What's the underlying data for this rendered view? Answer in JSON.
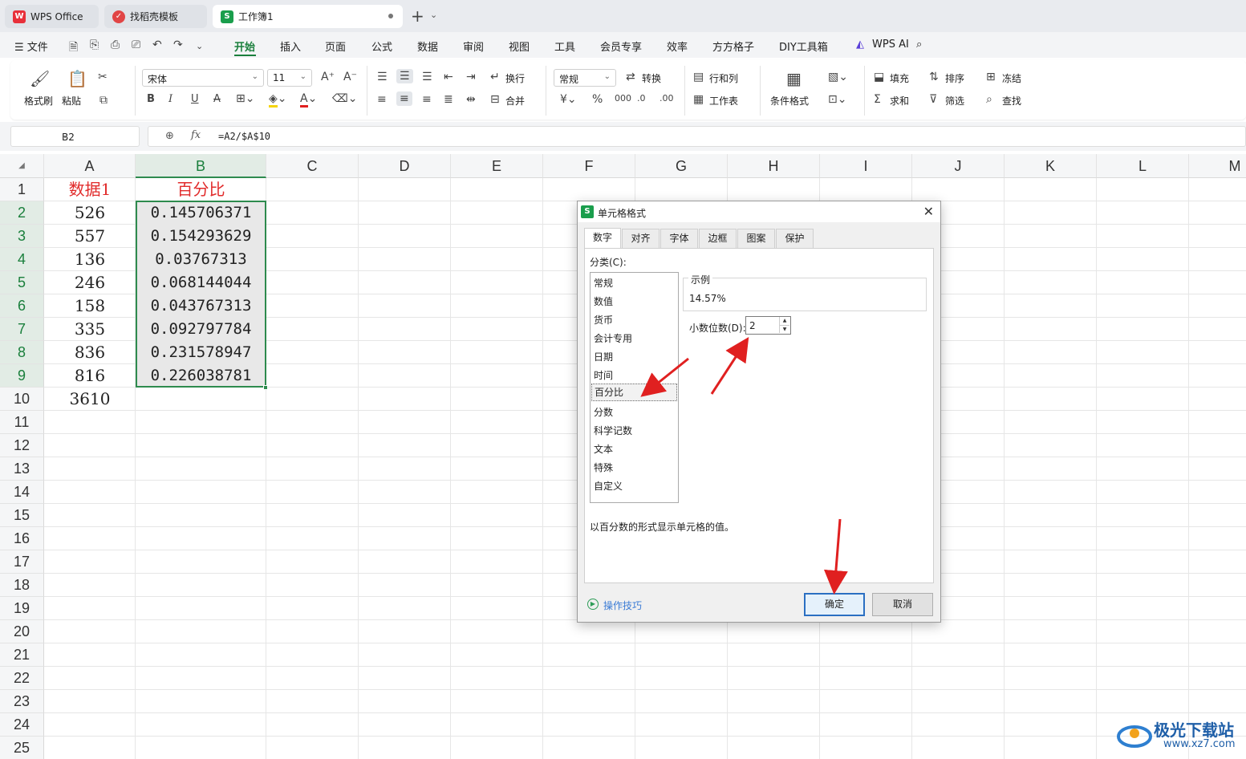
{
  "tabs": [
    {
      "label": "WPS Office",
      "icon": "wps-logo-icon"
    },
    {
      "label": "找稻壳模板",
      "icon": "docer-icon"
    },
    {
      "label": "工作簿1",
      "icon": "sheet-s-icon"
    }
  ],
  "menu": {
    "file": "文件",
    "items": [
      "开始",
      "插入",
      "页面",
      "公式",
      "数据",
      "审阅",
      "视图",
      "工具",
      "会员专享",
      "效率",
      "方方格子",
      "DIY工具箱"
    ],
    "ai": "WPS AI"
  },
  "ribbon": {
    "format_painter": "格式刷",
    "paste": "粘贴",
    "font_name": "宋体",
    "font_size": "11",
    "wrap": "换行",
    "merge": "合并",
    "number_format": "常规",
    "convert": "转换",
    "rows_cols": "行和列",
    "worksheet": "工作表",
    "cond_format": "条件格式",
    "fill": "填充",
    "sort": "排序",
    "freeze": "冻结",
    "sum": "求和",
    "filter": "筛选",
    "find": "查找"
  },
  "formula_bar": {
    "cell_ref": "B2",
    "formula": "=A2/$A$10"
  },
  "columns": [
    "A",
    "B",
    "C",
    "D",
    "E",
    "F",
    "G",
    "H",
    "I",
    "J",
    "K",
    "L",
    "M"
  ],
  "rows": [
    "1",
    "2",
    "3",
    "4",
    "5",
    "6",
    "7",
    "8",
    "9",
    "10",
    "11",
    "12",
    "13",
    "14",
    "15",
    "16",
    "17",
    "18",
    "19",
    "20",
    "21",
    "22",
    "23",
    "24",
    "25"
  ],
  "cells": {
    "A": [
      "数据1",
      "526",
      "557",
      "136",
      "246",
      "158",
      "335",
      "836",
      "816",
      "3610"
    ],
    "B": [
      "百分比",
      "0.145706371",
      "0.154293629",
      "0.03767313",
      "0.068144044",
      "0.043767313",
      "0.092797784",
      "0.231578947",
      "0.226038781"
    ]
  },
  "dialog": {
    "title": "单元格格式",
    "tabs": [
      "数字",
      "对齐",
      "字体",
      "边框",
      "图案",
      "保护"
    ],
    "category_label": "分类(C):",
    "categories": [
      "常规",
      "数值",
      "货币",
      "会计专用",
      "日期",
      "时间",
      "百分比",
      "分数",
      "科学记数",
      "文本",
      "特殊",
      "自定义"
    ],
    "selected_category": "百分比",
    "sample_label": "示例",
    "sample_value": "14.57%",
    "decimals_label": "小数位数(D):",
    "decimals_value": "2",
    "description": "以百分数的形式显示单元格的值。",
    "tips": "操作技巧",
    "ok": "确定",
    "cancel": "取消"
  },
  "watermark": {
    "name": "极光下载站",
    "url": "www.xz7.com"
  },
  "colors": {
    "accent_green": "#1a7f3c",
    "arrow_red": "#e02020",
    "header_red": "#e12b2b"
  }
}
